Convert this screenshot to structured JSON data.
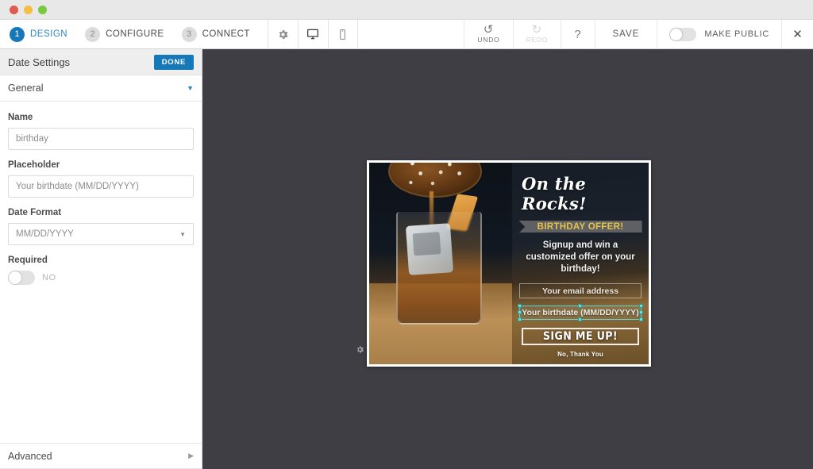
{
  "window": {
    "traffic_lights": [
      "close",
      "minimize",
      "maximize"
    ]
  },
  "toolbar": {
    "steps": [
      {
        "num": "1",
        "label": "DESIGN",
        "active": true
      },
      {
        "num": "2",
        "label": "CONFIGURE",
        "active": false
      },
      {
        "num": "3",
        "label": "CONNECT",
        "active": false
      }
    ],
    "icons": [
      {
        "name": "gear-icon",
        "glyph": "⚙"
      },
      {
        "name": "desktop-preview-icon",
        "glyph": "⌨"
      },
      {
        "name": "mobile-preview-icon",
        "glyph": "▯"
      }
    ],
    "undo_label": "UNDO",
    "undo_glyph": "↺",
    "redo_label": "REDO",
    "redo_glyph": "↻",
    "help_label": "?",
    "save_label": "SAVE",
    "make_public_label": "MAKE PUBLIC",
    "make_public_state": "off",
    "close_glyph": "✕",
    "accent_color": "#1579b9"
  },
  "sidebar": {
    "panel_title": "Date Settings",
    "done_label": "DONE",
    "section_general": "General",
    "section_general_caret": "▼",
    "fields": [
      {
        "label": "Name",
        "value": "birthday"
      },
      {
        "label": "Placeholder",
        "value": "Your birthdate (MM/DD/YYYY)"
      },
      {
        "label": "Date Format",
        "value": "MM/DD/YYYY",
        "caret": "▼"
      }
    ],
    "required_label": "Required",
    "required_value": "NO",
    "advanced_label": "Advanced",
    "advanced_caret": "▶"
  },
  "canvas": {
    "background_color": "#3e3e44",
    "gear_glyph": "⚙"
  },
  "popup": {
    "title": "On the Rocks!",
    "ribbon_text": "BIRTHDAY OFFER!",
    "subtitle": "Signup and win a customized offer on your birthday!",
    "email_placeholder": "Your email address",
    "date_placeholder": "Your birthdate (MM/DD/YYYY)",
    "button_label": "SIGN ME UP!",
    "decline_label": "No, Thank You",
    "ribbon_text_color": "#e7c34a",
    "selection_handle_color": "#66e0d8"
  }
}
